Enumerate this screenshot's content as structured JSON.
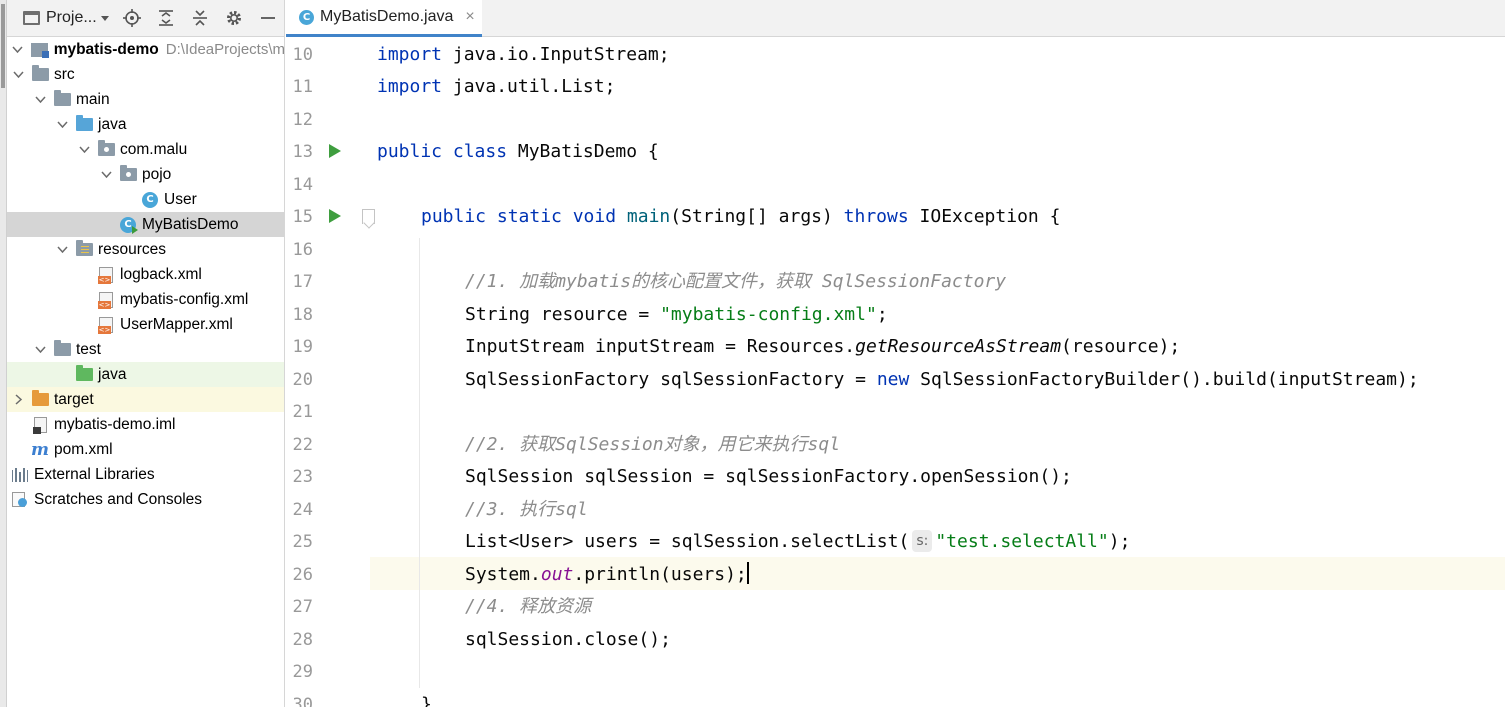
{
  "project_panel": {
    "title": "Proje...",
    "tree": [
      {
        "label": "mybatis-demo",
        "path": "D:\\IdeaProjects\\m",
        "icon": "module-icon"
      },
      {
        "label": "src",
        "icon": "folder-icon"
      },
      {
        "label": "main",
        "icon": "folder-icon"
      },
      {
        "label": "java",
        "icon": "source-folder-icon"
      },
      {
        "label": "com.malu",
        "icon": "package-icon"
      },
      {
        "label": "pojo",
        "icon": "package-icon"
      },
      {
        "label": "User",
        "icon": "class-icon"
      },
      {
        "label": "MyBatisDemo",
        "icon": "class-icon"
      },
      {
        "label": "resources",
        "icon": "resources-folder-icon"
      },
      {
        "label": "logback.xml",
        "icon": "xml-file-icon"
      },
      {
        "label": "mybatis-config.xml",
        "icon": "xml-file-icon"
      },
      {
        "label": "UserMapper.xml",
        "icon": "xml-file-icon"
      },
      {
        "label": "test",
        "icon": "folder-icon"
      },
      {
        "label": "java",
        "icon": "test-source-folder-icon"
      },
      {
        "label": "target",
        "icon": "excluded-folder-icon"
      },
      {
        "label": "mybatis-demo.iml",
        "icon": "iml-file-icon"
      },
      {
        "label": "pom.xml",
        "icon": "maven-icon"
      },
      {
        "label": "External Libraries",
        "icon": "libraries-icon"
      },
      {
        "label": "Scratches and Consoles",
        "icon": "scratches-icon"
      }
    ]
  },
  "editor": {
    "tab": {
      "label": "MyBatisDemo.java",
      "close": "×"
    },
    "line_numbers": [
      "10",
      "11",
      "12",
      "13",
      "14",
      "15",
      "16",
      "17",
      "18",
      "19",
      "20",
      "21",
      "22",
      "23",
      "24",
      "25",
      "26",
      "27",
      "28",
      "29",
      "30"
    ],
    "code": {
      "l10": {
        "kw": "import",
        "rest": " java.io.InputStream;"
      },
      "l11": {
        "kw": "import",
        "rest": " java.util.List;"
      },
      "l13": {
        "kw": "public class",
        "rest": " MyBatisDemo {"
      },
      "l15": {
        "kw1": "public static void",
        "fn": "main",
        "mid": "(String[] args) ",
        "kw2": "throws",
        "rest": " IOException {"
      },
      "l17": {
        "comment": "//1. 加载mybatis的核心配置文件，获取 SqlSessionFactory"
      },
      "l18": {
        "pre": "String resource = ",
        "str": "\"mybatis-config.xml\"",
        "post": ";"
      },
      "l19": {
        "pre": "InputStream inputStream = Resources.",
        "ital": "getResourceAsStream",
        "post": "(resource);"
      },
      "l20": {
        "pre": "SqlSessionFactory sqlSessionFactory = ",
        "kw": "new",
        "post": " SqlSessionFactoryBuilder().build(inputStream);"
      },
      "l22": {
        "comment": "//2. 获取SqlSession对象，用它来执行sql"
      },
      "l23": {
        "pre": "SqlSession sqlSession = sqlSessionFactory.openSession();"
      },
      "l24": {
        "comment": "//3. 执行sql"
      },
      "l25": {
        "pre": "List<User> users = sqlSession.selectList(",
        "hint": "s:",
        "str": "\"test.selectAll\"",
        "post": ");"
      },
      "l26": {
        "pre": "System.",
        "stat": "out",
        "post": ".println(users);"
      },
      "l27": {
        "comment": "//4. 释放资源"
      },
      "l28": {
        "pre": "sqlSession.close();"
      },
      "l30": {
        "pre": "}"
      }
    }
  },
  "colors": {
    "keyword": "#0033b3",
    "string": "#067d17",
    "comment": "#8c8c8c",
    "static_field": "#871094",
    "method_decl": "#00627a",
    "selection": "#d5d5d5",
    "current_line": "#fcfaed"
  }
}
